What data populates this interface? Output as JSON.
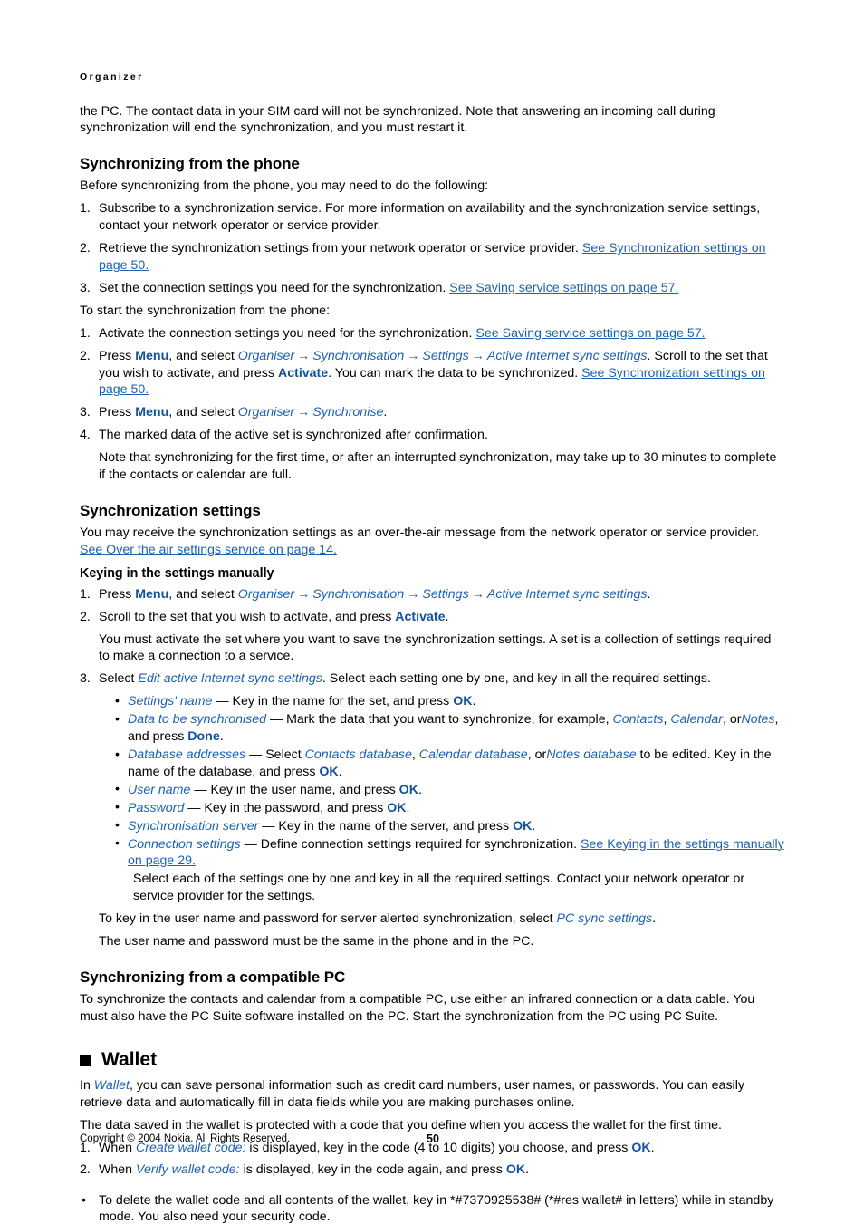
{
  "document": {
    "running_head": "Organizer",
    "footer": {
      "copyright": "Copyright © 2004 Nokia. All Rights Reserved.",
      "page_number": "50"
    }
  },
  "intro": {
    "continued_paragraph_a": "the PC. The contact data in your SIM card will not be synchronized. Note that answering an incoming call during",
    "continued_paragraph_b": "synchronization will end the synchronization, and you must restart it."
  },
  "sync_from_phone": {
    "heading": "Synchronizing from the phone",
    "lead_in": "Before synchronizing from the phone, you may need to do the following:",
    "prep_steps": [
      {
        "number": "1.",
        "text": "Subscribe to a synchronization service. For more information on availability and the synchronization service settings, contact your network operator or service provider."
      },
      {
        "number": "2.",
        "text_before": "Retrieve the synchronization settings from your network operator or service provider. ",
        "xref": "See Synchronization settings on page 50."
      },
      {
        "number": "3.",
        "text_before": "Set the connection settings you need for the synchronization. ",
        "xref": "See Saving service settings on page 57."
      }
    ],
    "start_lead_in": "To start the synchronization from the phone:",
    "start_steps": {
      "step1": {
        "number": "1.",
        "text_before": "Activate the connection settings you need for the synchronization. ",
        "xref": "See Saving service settings on page 57."
      },
      "step2": {
        "number": "2.",
        "press": "Press ",
        "key": "Menu",
        "and_select": ", and select ",
        "path": [
          "Organiser",
          "Synchronisation",
          "Settings",
          "Active Internet sync settings"
        ],
        "after_path": ". Scroll to the set that you wish to activate, and press ",
        "key2": "Activate",
        "after_key2": ". You can mark the data to be synchronized. ",
        "xref": "See Synchronization settings on page 50."
      },
      "step3": {
        "number": "3.",
        "press": "Press ",
        "key": "Menu",
        "and_select": ", and select ",
        "path": [
          "Organiser",
          "Synchronise"
        ],
        "after_path": "."
      },
      "step4": {
        "number": "4.",
        "text": "The marked data of the active set is synchronized after confirmation.",
        "note": "Note that synchronizing for the first time, or after an interrupted synchronization, may take up to 30 minutes to complete if the contacts or calendar are full."
      }
    }
  },
  "sync_settings": {
    "heading": "Synchronization settings",
    "intro_before": "You may receive the synchronization settings as an over-the-air message from the network operator or service provider. ",
    "intro_xref": "See Over the air settings service on page 14.",
    "subheading": "Keying in the settings manually",
    "step1": {
      "number": "1.",
      "press": "Press ",
      "key": "Menu",
      "and_select": ", and select ",
      "path": [
        "Organiser",
        "Synchronisation",
        "Settings",
        "Active Internet sync settings"
      ],
      "after_path": "."
    },
    "step2": {
      "number": "2.",
      "text_before": "Scroll to the set that you wish to activate, and press ",
      "key": "Activate",
      "after_key": ".",
      "note": "You must activate the set where you want to save the synchronization settings. A set is a collection of settings required to make a connection to a service."
    },
    "step3": {
      "number": "3.",
      "text_before": "Select ",
      "menuitem": "Edit active Internet sync settings",
      "text_after": ". Select each setting one by one, and key in all the required settings."
    },
    "settings_bullets": [
      {
        "marker": "•",
        "term": "Settings' name",
        "dash": " — ",
        "desc_before": "Key in the name for the set, and press ",
        "key": "OK",
        "desc_after": "."
      },
      {
        "marker": "•",
        "term": "Data to be synchronised",
        "dash": " — ",
        "desc_before": "Mark the data that you want to synchronize, for example, ",
        "inline_items": [
          "Contacts",
          "Calendar",
          "Notes"
        ],
        "desc_mid": ", and press ",
        "key": "Done",
        "desc_after": "."
      },
      {
        "marker": "•",
        "term": "Database addresses",
        "dash": " — ",
        "desc_before": "Select ",
        "inline_items": [
          "Contacts database",
          "Calendar database",
          "Notes database"
        ],
        "desc_mid": " to be edited. Key in the name of the database, and press ",
        "key": "OK",
        "desc_after": "."
      },
      {
        "marker": "•",
        "term": "User name",
        "dash": " — ",
        "desc_before": "Key in the user name, and press ",
        "key": "OK",
        "desc_after": "."
      },
      {
        "marker": "•",
        "term": "Password",
        "dash": " — ",
        "desc_before": "Key in the password, and press ",
        "key": "OK",
        "desc_after": "."
      },
      {
        "marker": "•",
        "term": "Synchronisation server",
        "dash": " — ",
        "desc_before": "Key in the name of the server, and press ",
        "key": "OK",
        "desc_after": "."
      },
      {
        "marker": "•",
        "term": "Connection settings",
        "dash": " — ",
        "desc_before": "Define connection settings required for synchronization. ",
        "xref": "See Keying in the settings manually on page 29."
      }
    ],
    "after_bullets_note": "Select each of the settings one by one and key in all the required settings. Contact your network operator or service provider for the settings.",
    "pc_sync_before": "To key in the user name and password for server alerted synchronization, select ",
    "pc_sync_item": "PC sync settings",
    "pc_sync_after": ".",
    "same_credentials": "The user name and password must be the same in the phone and in the PC."
  },
  "sync_from_pc": {
    "heading": "Synchronizing from a compatible PC",
    "body": "To synchronize the contacts and calendar from a compatible PC, use either an infrared connection or a data cable. You must also have the PC Suite software installed on the PC. Start the synchronization from the PC using PC Suite."
  },
  "wallet": {
    "chapter_title": "Wallet",
    "intro_before": "In ",
    "intro_item": "Wallet",
    "intro_after": ", you can save personal information such as credit card numbers, user names, or passwords. You can easily retrieve data and automatically fill in data fields while you are making purchases online.",
    "protection": "The data saved in the wallet is protected with a code that you define when you access the wallet for the first time.",
    "step1": {
      "number": "1.",
      "text_before": "When ",
      "menuitem": "Create wallet code:",
      "text_mid": " is displayed, key in the code (4 to 10 digits) you choose, and press ",
      "key": "OK",
      "text_after": "."
    },
    "step2": {
      "number": "2.",
      "text_before": "When ",
      "menuitem": "Verify wallet code:",
      "text_mid": " is displayed, key in the code again, and press ",
      "key": "OK",
      "text_after": "."
    },
    "delete_bullet": {
      "marker": "•",
      "text": "To delete the wallet code and all contents of the wallet, key in *#7370925538# (*#res wallet# in letters) while in standby mode. You also need your security code."
    }
  },
  "symbols": {
    "arrow": "→"
  },
  "colors": {
    "link_blue": "#1c62b3",
    "key_blue": "#1152a0",
    "text_black": "#000000"
  }
}
